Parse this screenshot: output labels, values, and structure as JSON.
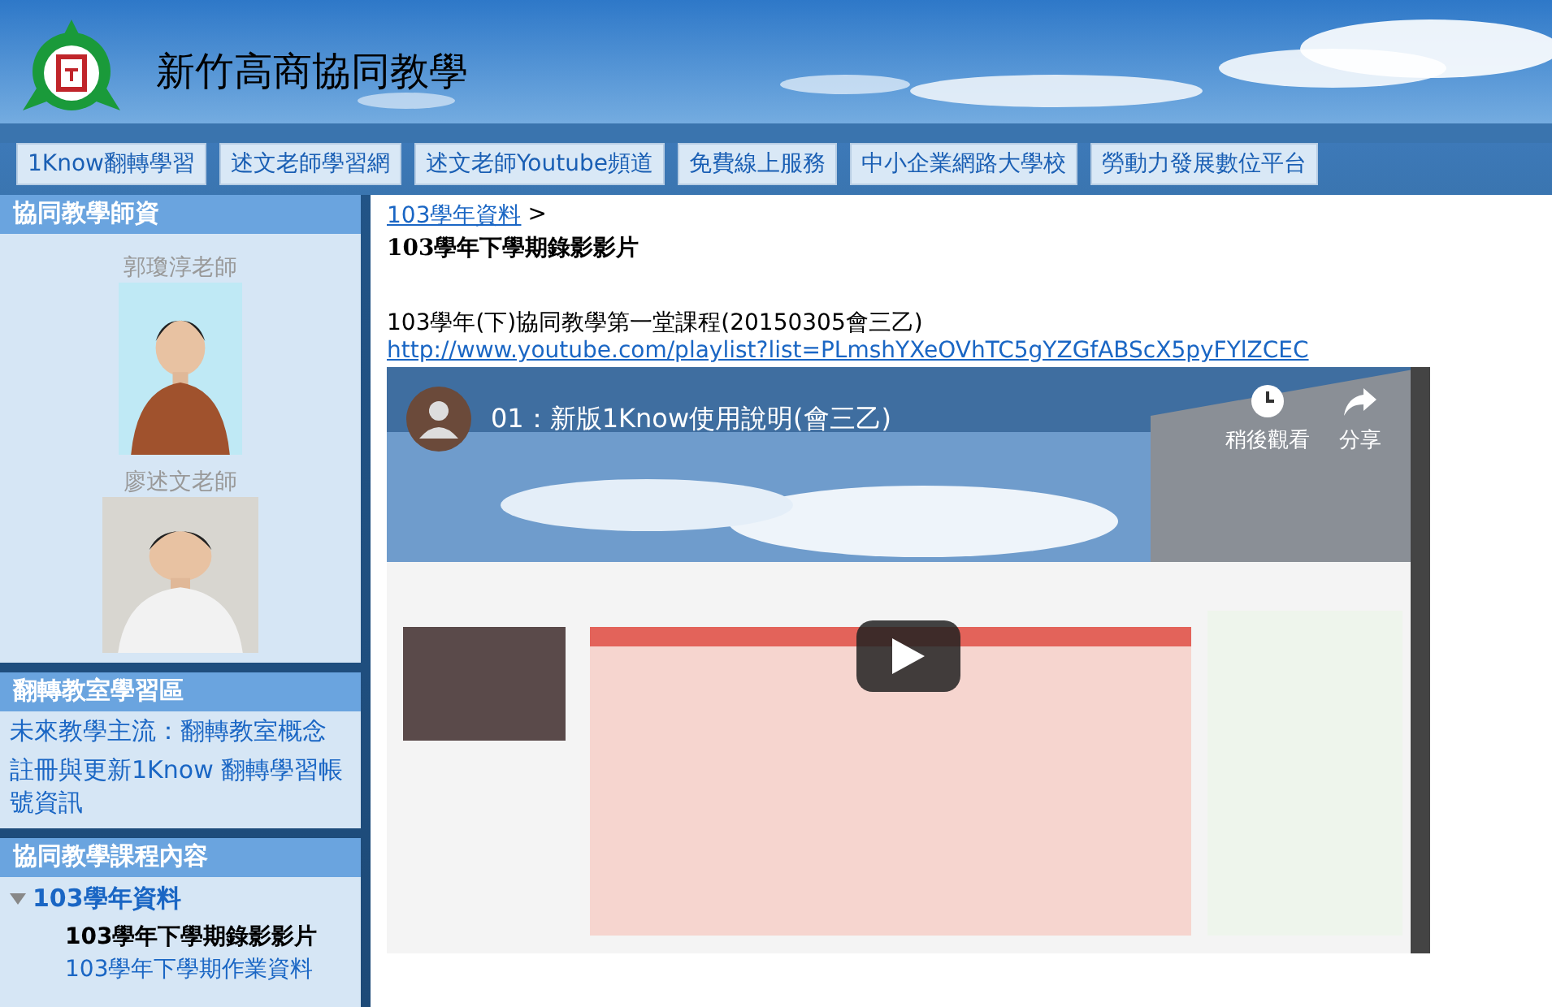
{
  "site": {
    "title": "新竹高商協同教學"
  },
  "nav": [
    "1Know翻轉學習",
    "述文老師學習網",
    "述文老師Youtube頻道",
    "免費線上服務",
    "中小企業網路大學校",
    "勞動力發展數位平台"
  ],
  "sidebar": [
    {
      "kind": "teachers",
      "title": "協同教學師資",
      "teachers": [
        {
          "name": "郭瓊淳老師"
        },
        {
          "name": "廖述文老師"
        }
      ]
    },
    {
      "kind": "links",
      "title": "翻轉教室學習區",
      "links": [
        "未來教學主流：翻轉教室概念",
        "註冊與更新1Know 翻轉學習帳號資訊"
      ]
    },
    {
      "kind": "tree",
      "title": "協同教學課程內容",
      "items": [
        {
          "label": "103學年資料",
          "expanded": true,
          "children": [
            {
              "label": "103學年下學期錄影影片",
              "selected": true
            },
            {
              "label": "103學年下學期作業資料",
              "selected": false
            }
          ]
        }
      ]
    }
  ],
  "main": {
    "breadcrumb": {
      "link": "103學年資料",
      "separator": ">"
    },
    "heading": "103學年下學期錄影影片",
    "video_title": "103學年(下)協同教學第一堂課程(20150305會三乙)",
    "url": "http://www.youtube.com/playlist?list=PLmshYXeOVhTC5gYZGfABScX5pyFYlZCEC",
    "player": {
      "title": "01：新版1Know使用說明(會三乙)",
      "watch_later": "稍後觀看",
      "share": "分享"
    }
  }
}
